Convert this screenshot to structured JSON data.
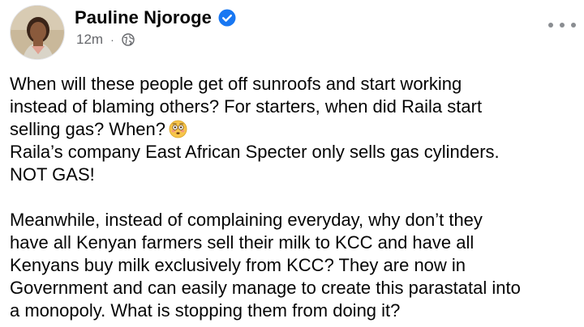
{
  "post": {
    "author_name": "Pauline Njoroge",
    "timestamp": "12m",
    "separator": "·",
    "privacy_icon": "globe-icon",
    "verified_icon": "verified-badge-icon",
    "more_icon": "more-options-icon",
    "paragraph_1_lines": [
      "When will these people get off sunroofs and start working",
      "instead of blaming others? For starters, when did Raila start",
      "selling gas? When?"
    ],
    "emoji": "flushed-face-emoji",
    "paragraph_1_rest": [
      "Raila’s company East African Specter only sells gas cylinders.",
      "NOT GAS!"
    ],
    "paragraph_2_lines": [
      "Meanwhile, instead of complaining everyday, why don’t they",
      "have all Kenyan farmers sell their milk to KCC and have all",
      "Kenyans buy milk exclusively from KCC? They are now in",
      "Government and can easily manage to create this parastatal into",
      "a monopoly. What is stopping them from doing it?"
    ]
  },
  "colors": {
    "name_text": "#050505",
    "meta_text": "#65676b",
    "verified_blue": "#1877f2",
    "body_text": "#050505"
  }
}
